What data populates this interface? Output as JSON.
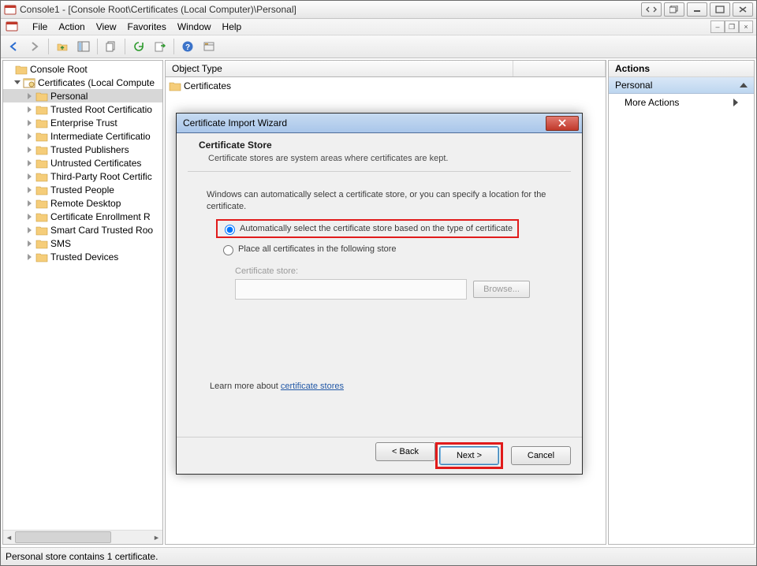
{
  "titlebar": {
    "title": "Console1 - [Console Root\\Certificates (Local Computer)\\Personal]"
  },
  "menubar": {
    "items": [
      "File",
      "Action",
      "View",
      "Favorites",
      "Window",
      "Help"
    ]
  },
  "tree": {
    "root": "Console Root",
    "cert_node": "Certificates (Local Compute",
    "children": [
      "Personal",
      "Trusted Root Certificatio",
      "Enterprise Trust",
      "Intermediate Certificatio",
      "Trusted Publishers",
      "Untrusted Certificates",
      "Third-Party Root Certific",
      "Trusted People",
      "Remote Desktop",
      "Certificate Enrollment R",
      "Smart Card Trusted Roo",
      "SMS",
      "Trusted Devices"
    ]
  },
  "list": {
    "header": "Object Type",
    "row0": "Certificates"
  },
  "actions": {
    "title": "Actions",
    "section": "Personal",
    "item0": "More Actions"
  },
  "status": "Personal store contains 1 certificate.",
  "wizard": {
    "title": "Certificate Import Wizard",
    "heading": "Certificate Store",
    "subheading": "Certificate stores are system areas where certificates are kept.",
    "desc": "Windows can automatically select a certificate store, or you can specify a location for the certificate.",
    "radio_auto": "Automatically select the certificate store based on the type of certificate",
    "radio_place": "Place all certificates in the following store",
    "store_label": "Certificate store:",
    "browse": "Browse...",
    "learn_prefix": "Learn more about ",
    "learn_link": "certificate stores",
    "back": "< Back",
    "next": "Next >",
    "cancel": "Cancel"
  }
}
